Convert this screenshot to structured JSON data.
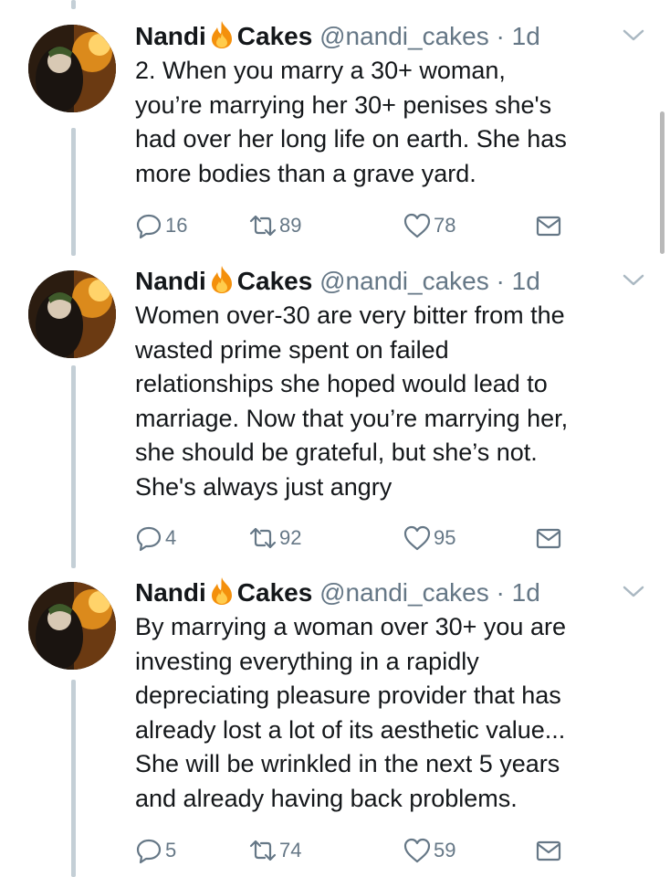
{
  "tweets": [
    {
      "author_name_first": "Nandi",
      "author_name_second": "Cakes",
      "handle": "@nandi_cakes",
      "time": "· 1d",
      "text": "2. When you marry a 30+ woman,\nyou’re marrying her 30+ penises she's\nhad over her long life on earth. She has\nmore bodies than a grave yard.",
      "replies": "16",
      "retweets": "89",
      "likes": "78"
    },
    {
      "author_name_first": "Nandi",
      "author_name_second": "Cakes",
      "handle": "@nandi_cakes",
      "time": "· 1d",
      "text": "Women over-30 are very bitter from the\nwasted prime spent on failed\nrelationships she hoped would lead to\nmarriage. Now that you’re marrying her,\nshe should be grateful, but she’s not.\nShe's always just angry",
      "replies": "4",
      "retweets": "92",
      "likes": "95"
    },
    {
      "author_name_first": "Nandi",
      "author_name_second": "Cakes",
      "handle": "@nandi_cakes",
      "time": "· 1d",
      "text": "By marrying a woman over 30+ you are\ninvesting everything in a rapidly\ndepreciating pleasure provider that has\nalready lost a lot of its aesthetic value...\nShe will be wrinkled in the next 5 years\nand already having back problems.",
      "replies": "5",
      "retweets": "74",
      "likes": "59"
    }
  ],
  "icons": {
    "name_emoji": "fire-icon",
    "reply": "reply-icon",
    "retweet": "retweet-icon",
    "like": "heart-icon",
    "dm": "envelope-icon",
    "menu": "chevron-down-icon"
  },
  "colors": {
    "icon_gray": "#657786",
    "thread_line": "#c4cfd6",
    "fire_orange": "#f4900c"
  }
}
